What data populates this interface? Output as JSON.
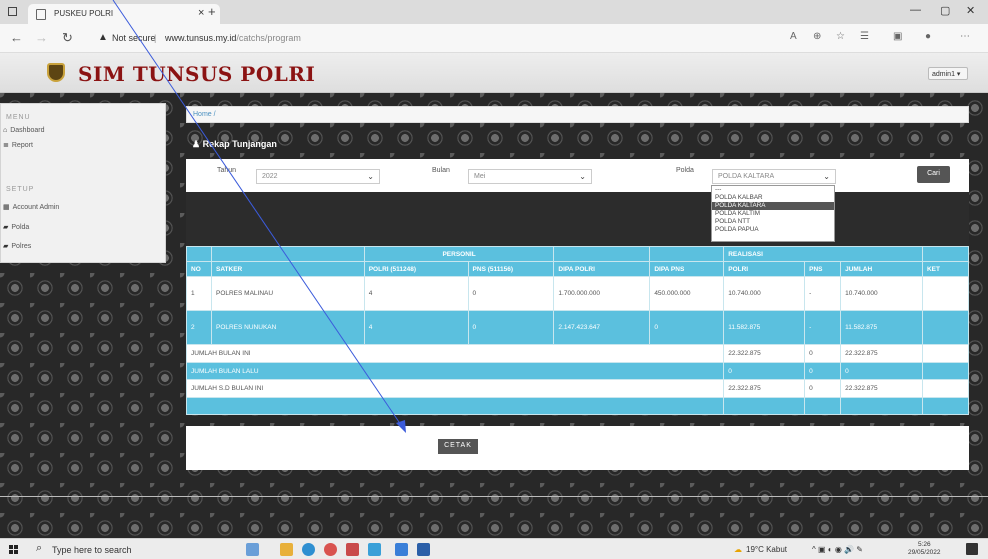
{
  "browser": {
    "tab_title": "PUSKEU POLRI",
    "tab_close": "×",
    "new_tab": "+",
    "not_secure": "Not secure",
    "separator": "|",
    "url_host": "www.tunsus.my.id",
    "url_path": "/catchs/program",
    "window_controls": [
      "—",
      "▢",
      "✕"
    ]
  },
  "site": {
    "title": "SIM TUNSUS POLRI",
    "admin_label": "admin1 ▾"
  },
  "sidebar": {
    "menu_heading": "MENU",
    "menu_items": [
      {
        "label": "Dashboard",
        "icon": "home-icon"
      },
      {
        "label": "Report",
        "icon": "list-icon"
      }
    ],
    "setup_heading": "SETUP",
    "setup_items": [
      {
        "label": "Account Admin",
        "icon": "table-icon"
      },
      {
        "label": "Polda",
        "icon": "flag-icon"
      },
      {
        "label": "Polres",
        "icon": "flag-icon"
      }
    ]
  },
  "main": {
    "breadcrumb": "Home /",
    "section_title": "Rekap Tunjangan",
    "filters": {
      "tahun_label": "Tahun",
      "tahun_value": "2022",
      "bulan_label": "Bulan",
      "bulan_value": "Mei",
      "polda_label": "Polda",
      "polda_value": "POLDA KALTARA",
      "search_button": "Cari"
    },
    "polda_options": [
      "---",
      "POLDA KALBAR",
      "POLDA KALTARA",
      "POLDA KALTIM",
      "POLDA NTT",
      "POLDA PAPUA"
    ],
    "polda_selected_index": 2,
    "table": {
      "group_headers": {
        "personil": "PERSONIL",
        "realisasi": "REALISASI"
      },
      "columns": [
        "NO",
        "SATKER",
        "POLRI (511248)",
        "PNS (511156)",
        "DIPA POLRI",
        "DIPA PNS",
        "POLRI",
        "PNS",
        "JUMLAH",
        "KET"
      ],
      "rows": [
        {
          "no": "1",
          "satker": "POLRES MALINAU",
          "polri": "4",
          "pns": "0",
          "dipa_polri": "1.700.000.000",
          "dipa_pns": "450.000.000",
          "real_polri": "10.740.000",
          "real_pns": "-",
          "jumlah": "10.740.000",
          "ket": ""
        },
        {
          "no": "2",
          "satker": "POLRES NUNUKAN",
          "polri": "4",
          "pns": "0",
          "dipa_polri": "2.147.423.647",
          "dipa_pns": "0",
          "real_polri": "11.582.875",
          "real_pns": "-",
          "jumlah": "11.582.875",
          "ket": ""
        }
      ],
      "summary": [
        {
          "label": "JUMLAH BULAN INI",
          "polri": "22.322.875",
          "pns": "0",
          "jumlah": "22.322.875"
        },
        {
          "label": "JUMLAH BULAN LALU",
          "polri": "0",
          "pns": "0",
          "jumlah": "0"
        },
        {
          "label": "JUMLAH S.D BULAN INI",
          "polri": "22.322.875",
          "pns": "0",
          "jumlah": "22.322.875"
        }
      ]
    },
    "print_button": "CETAK"
  },
  "taskbar": {
    "search_placeholder": "Type here to search",
    "weather": "19°C  Kabut",
    "time": "5:26",
    "date": "29/05/2022"
  }
}
